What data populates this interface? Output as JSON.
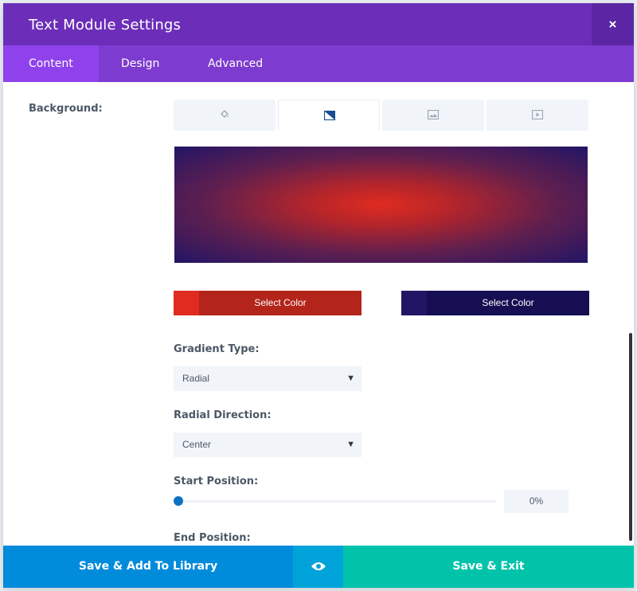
{
  "modal": {
    "title": "Text Module Settings",
    "close_label": "×"
  },
  "tabs": [
    {
      "label": "Content",
      "active": true
    },
    {
      "label": "Design",
      "active": false
    },
    {
      "label": "Advanced",
      "active": false
    }
  ],
  "background": {
    "label": "Background:",
    "type_tabs": [
      {
        "icon": "paint-bucket-icon",
        "active": false
      },
      {
        "icon": "gradient-icon",
        "active": true
      },
      {
        "icon": "image-icon",
        "active": false
      },
      {
        "icon": "video-icon",
        "active": false
      }
    ],
    "gradient_start_color": "#e02b20",
    "gradient_end_color": "#221566",
    "color_button_1": {
      "label": "Select Color",
      "swatch": "#e02b20",
      "fill": "#b3241b"
    },
    "color_button_2": {
      "label": "Select Color",
      "swatch": "#221566",
      "fill": "#150e52"
    }
  },
  "gradient_type": {
    "label": "Gradient Type:",
    "value": "Radial"
  },
  "radial_direction": {
    "label": "Radial Direction:",
    "value": "Center"
  },
  "start_position": {
    "label": "Start Position:",
    "value": "0%",
    "fraction": 0
  },
  "end_position": {
    "label": "End Position:"
  },
  "footer": {
    "save_library_label": "Save & Add To Library",
    "preview_icon": "eye-icon",
    "save_exit_label": "Save & Exit"
  },
  "colors": {
    "title_bar": "#6c2eb9",
    "tab_bar": "#7e3bd0",
    "active_tab": "#8f42ec",
    "library_button": "#008bdb",
    "preview_button": "#00a3d9",
    "exit_button": "#00c3aa",
    "slider_handle": "#0c71c3"
  }
}
